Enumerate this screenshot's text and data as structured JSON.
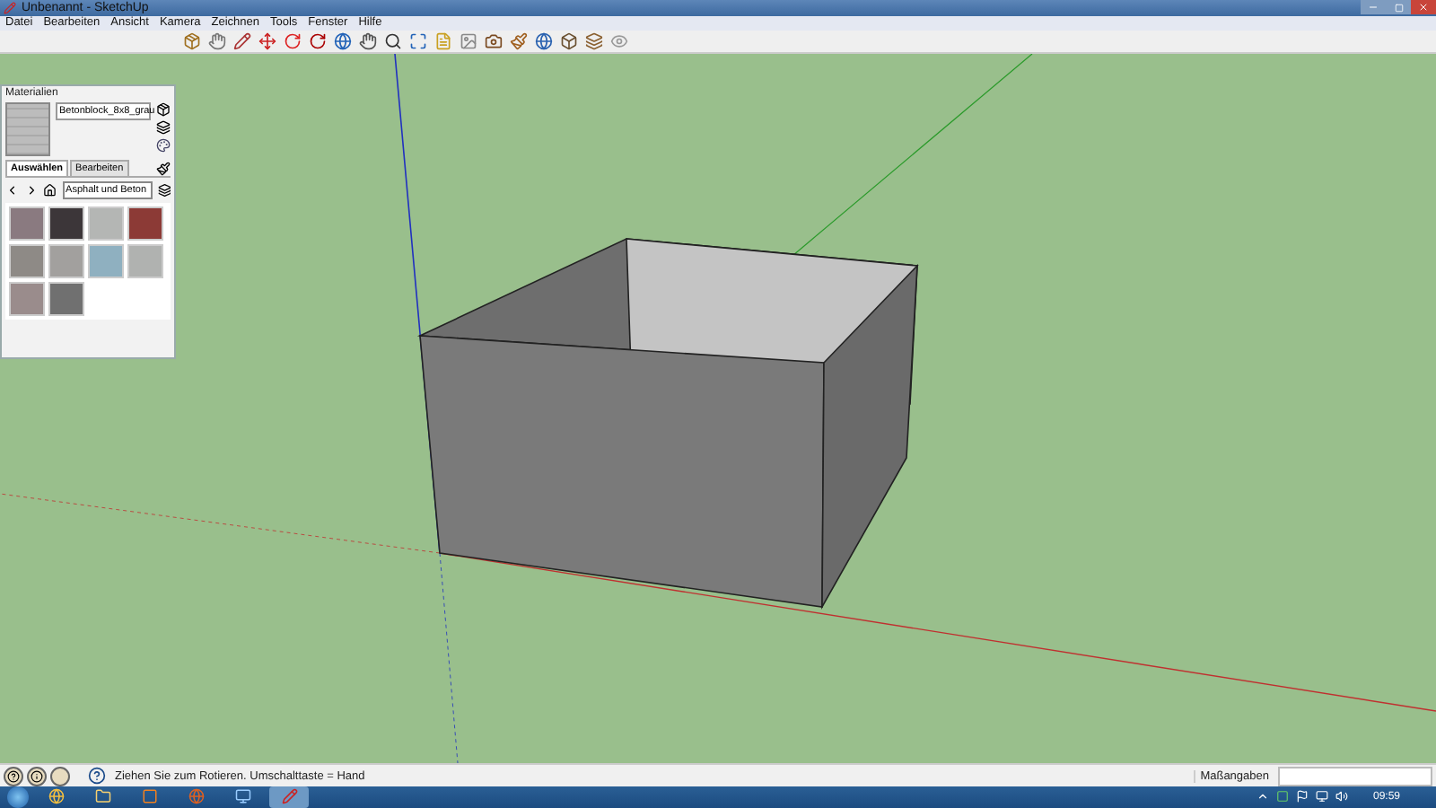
{
  "window": {
    "title": "Unbenannt - SketchUp"
  },
  "menu": [
    "Datei",
    "Bearbeiten",
    "Ansicht",
    "Kamera",
    "Zeichnen",
    "Tools",
    "Fenster",
    "Hilfe"
  ],
  "materials_panel": {
    "title": "Materialien",
    "material_name": "Betonblock_8x8_grau",
    "tabs": [
      {
        "label": "Auswählen",
        "selected": true
      },
      {
        "label": "Bearbeiten",
        "selected": false
      }
    ],
    "library": "Asphalt und Beton",
    "swatches": [
      {
        "color": "#8a7a80"
      },
      {
        "color": "#3c3639"
      },
      {
        "color": "#b4b6b4"
      },
      {
        "color": "#8c3a36"
      },
      {
        "color": "#8e8a86"
      },
      {
        "color": "#a2a09e"
      },
      {
        "color": "#8fb0c0"
      },
      {
        "color": "#b0b2b0"
      },
      {
        "color": "#9a8c8c"
      },
      {
        "color": "#707070"
      }
    ]
  },
  "status_bar": {
    "hint": "Ziehen Sie zum Rotieren.  Umschalttaste = Hand",
    "measure_label": "Maßangaben"
  },
  "taskbar": {
    "clock": "09:59"
  }
}
